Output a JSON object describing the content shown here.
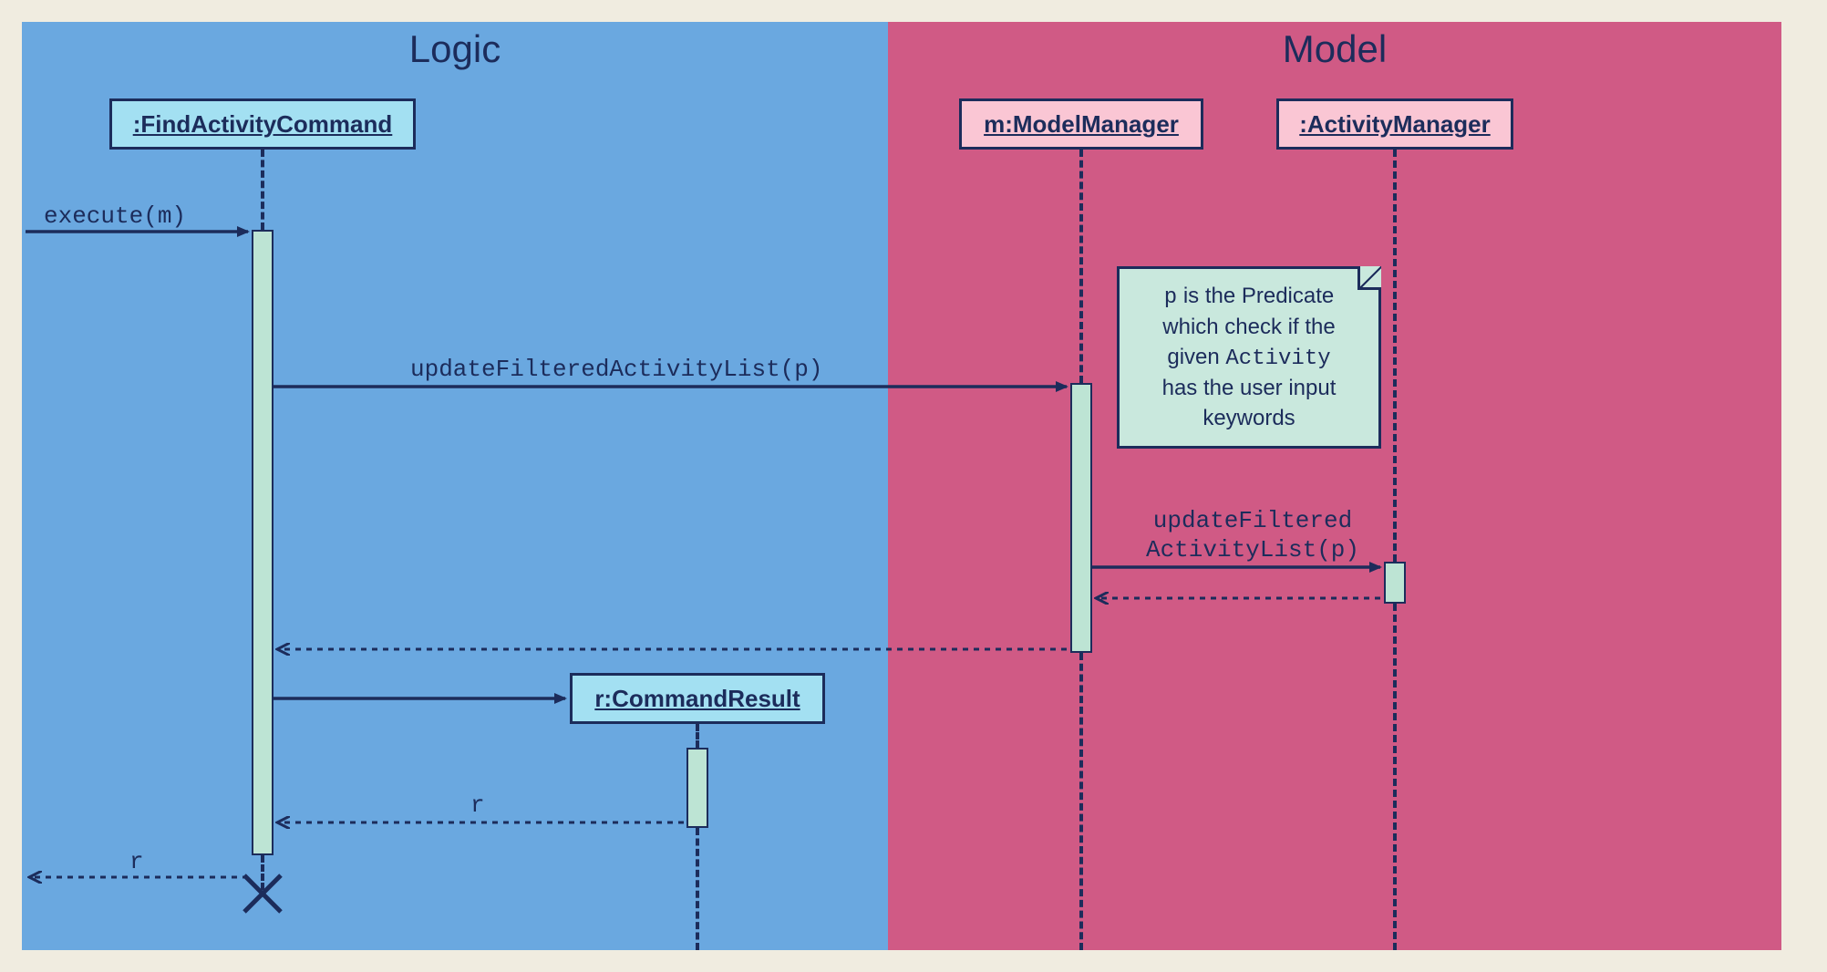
{
  "regions": {
    "logic_title": "Logic",
    "model_title": "Model"
  },
  "lifelines": {
    "find_activity_command": ":FindActivityCommand",
    "command_result": "r:CommandResult",
    "model_manager": "m:ModelManager",
    "activity_manager": ":ActivityManager"
  },
  "messages": {
    "execute": "execute(m)",
    "update_filtered_activity_list": "updateFilteredActivityList(p)",
    "update_filtered_line1": "updateFiltered",
    "update_filtered_line2": "ActivityList(p)",
    "return_r": "r",
    "return_r2": "r"
  },
  "note": {
    "line1_a": "p",
    "line1_b": " is the Predicate",
    "line2": "which check if the",
    "line3_a": "given ",
    "line3_b": "Activity",
    "line4": "has the user input",
    "line5": "keywords"
  }
}
